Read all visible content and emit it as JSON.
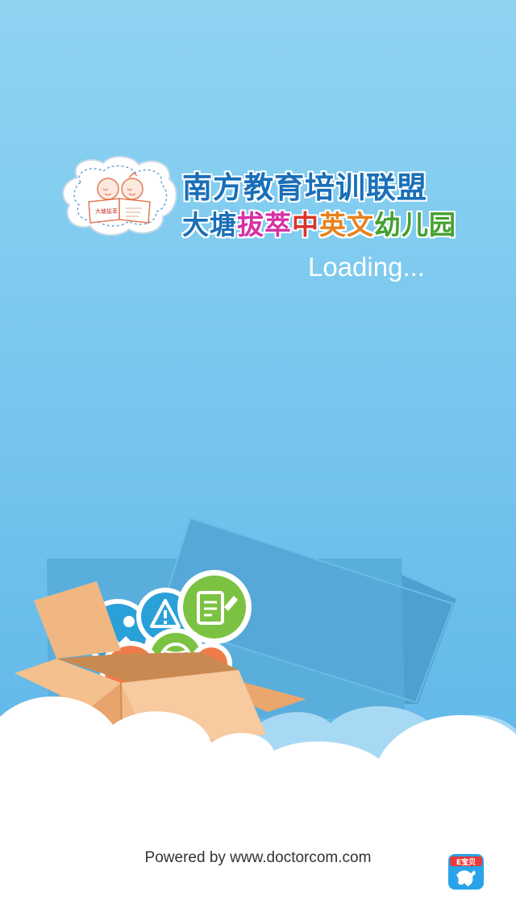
{
  "header": {
    "title_line1": "南方教育培训联盟",
    "title_line2": {
      "part1": "大塘",
      "part2": "拔萃",
      "part3": "中",
      "part4": "英",
      "part5": "文",
      "part6": "幼儿园"
    }
  },
  "logo": {
    "badge_text": "大塘拔萃",
    "icon_name": "kindergarten-logo-icon"
  },
  "status": {
    "loading_text": "Loading..."
  },
  "footer": {
    "powered_by": "Powered by www.doctorcom.com",
    "brand_badge_text": "E宝贝"
  },
  "colors": {
    "background_top": "#8fd4f1",
    "background_bottom": "#5cb4e6",
    "title_blue": "#1a6fb8",
    "accent_pink": "#d62fa6",
    "accent_red": "#d9342b",
    "accent_orange": "#e6821f",
    "accent_green": "#43a02f",
    "badge_blue": "#2aa3e8"
  },
  "illustration": {
    "icons": [
      "image-icon",
      "warning-icon",
      "note-edit-icon",
      "ball-icon",
      "chat-icon"
    ]
  }
}
